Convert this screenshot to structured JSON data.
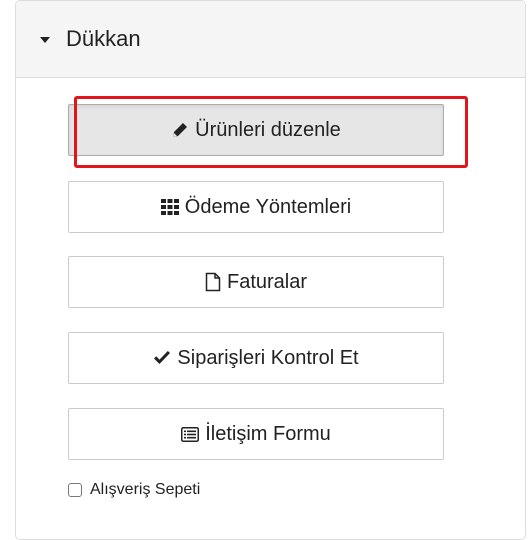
{
  "panel": {
    "title": "Dükkan",
    "caret_icon": "caret-down-icon"
  },
  "buttons": [
    {
      "label": "Ürünleri düzenle",
      "icon": "pencil-icon",
      "active": true,
      "highlighted": true
    },
    {
      "label": "Ödeme Yöntemleri",
      "icon": "grid-icon",
      "active": false
    },
    {
      "label": "Faturalar",
      "icon": "file-icon",
      "active": false
    },
    {
      "label": "Siparişleri Kontrol Et",
      "icon": "check-icon",
      "active": false
    },
    {
      "label": "İletişim Formu",
      "icon": "form-list-icon",
      "active": false
    }
  ],
  "checkbox": {
    "label": "Alışveriş Sepeti",
    "checked": false
  },
  "colors": {
    "highlight": "#e0161c",
    "header_bg": "#f5f5f5",
    "active_button_bg": "#e6e6e6"
  }
}
